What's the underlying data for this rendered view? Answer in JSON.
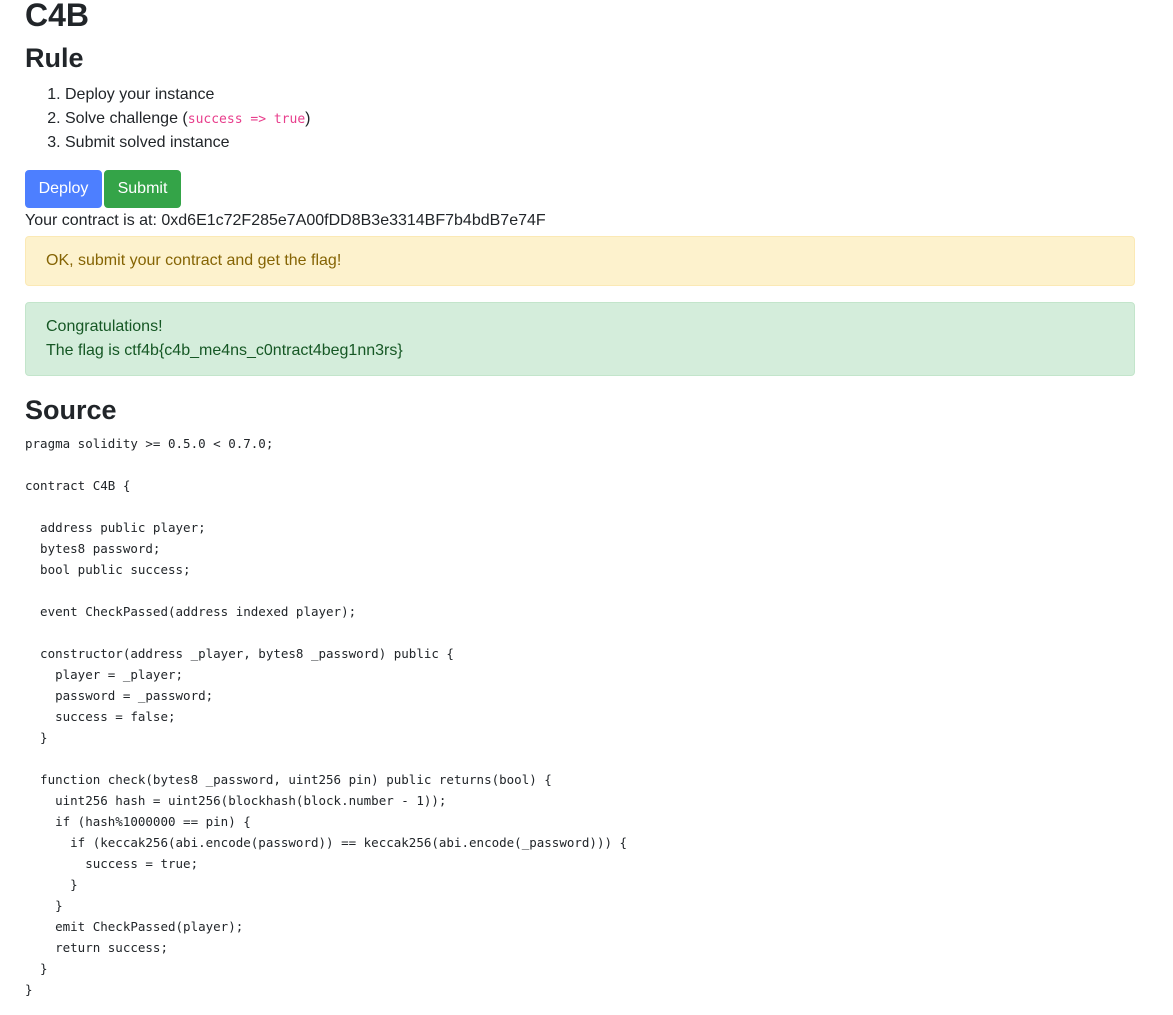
{
  "title": "C4B",
  "rule": {
    "heading": "Rule",
    "steps": [
      {
        "text": "Deploy your instance"
      },
      {
        "text_before": "Solve challenge (",
        "code": "success => true",
        "text_after": ")"
      },
      {
        "text": "Submit solved instance"
      }
    ]
  },
  "buttons": {
    "deploy_label": "Deploy",
    "submit_label": "Submit"
  },
  "contract_address_text": "Your contract is at: 0xd6E1c72F285e7A00fDD8B3e3314BF7b4bdB7e74F",
  "alerts": {
    "warning": "OK, submit your contract and get the flag!",
    "success_line1": "Congratulations!",
    "success_line2": "The flag is ctf4b{c4b_me4ns_c0ntract4beg1nn3rs}"
  },
  "source": {
    "heading": "Source",
    "code": "pragma solidity >= 0.5.0 < 0.7.0;\n\ncontract C4B {\n\n  address public player;\n  bytes8 password;\n  bool public success;\n\n  event CheckPassed(address indexed player);\n\n  constructor(address _player, bytes8 _password) public {\n    player = _player;\n    password = _password;\n    success = false;\n  }\n\n  function check(bytes8 _password, uint256 pin) public returns(bool) {\n    uint256 hash = uint256(blockhash(block.number - 1));\n    if (hash%1000000 == pin) {\n      if (keccak256(abi.encode(password)) == keccak256(abi.encode(_password))) {\n        success = true;\n      }\n    }\n    emit CheckPassed(player);\n    return success;\n  }\n}"
  },
  "colors": {
    "primary": "#4d7fff",
    "success": "#34a448",
    "warning_bg": "#fdf2cd",
    "success_bg": "#d4eddb",
    "code_pink": "#e83e8c"
  }
}
